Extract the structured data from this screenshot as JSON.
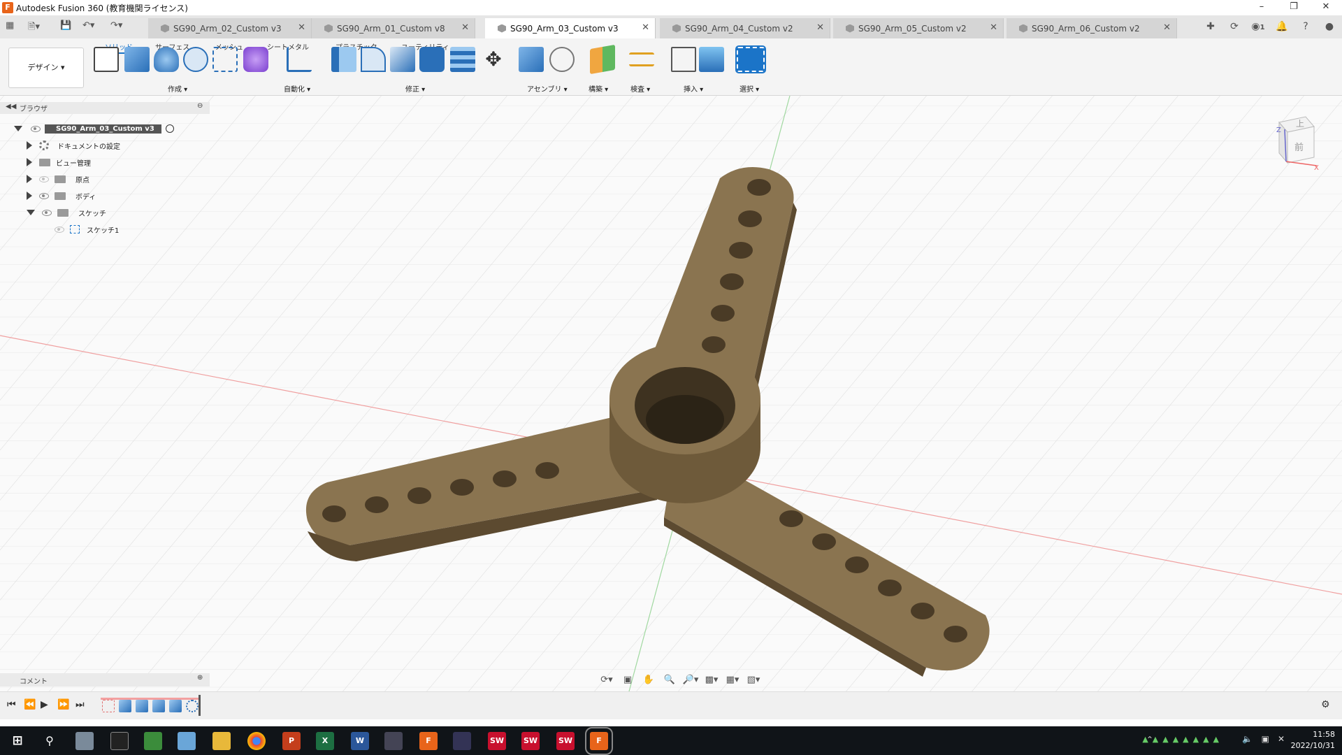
{
  "window": {
    "title": "Autodesk Fusion 360 (教育機関ライセンス)",
    "minimize_icon": "minimize-icon",
    "restore_icon": "restore-icon",
    "close_icon": "close-icon"
  },
  "tabs": [
    {
      "label": "SG90_Arm_02_Custom v3",
      "active": false
    },
    {
      "label": "SG90_Arm_01_Custom v8",
      "active": false
    },
    {
      "label": "SG90_Arm_03_Custom v3",
      "active": true
    },
    {
      "label": "SG90_Arm_04_Custom v2",
      "active": false
    },
    {
      "label": "SG90_Arm_05_Custom v2",
      "active": false
    },
    {
      "label": "SG90_Arm_06_Custom v2",
      "active": false
    }
  ],
  "tab_close_glyph": "✕",
  "header_right": {
    "job_count": "1"
  },
  "toolbar": {
    "workspace": "デザイン",
    "workspace_tabs": [
      "ソリッド",
      "サーフェス",
      "メッシュ",
      "シートメタル",
      "プラスチック",
      "ユーティリティ"
    ],
    "groups": [
      "作成",
      "自動化",
      "修正",
      "アセンブリ",
      "構築",
      "検査",
      "挿入",
      "選択"
    ]
  },
  "browser": {
    "title": "ブラウザ",
    "root": "SG90_Arm_03_Custom v3",
    "items": [
      {
        "label": "ドキュメントの設定",
        "icon": "gear-icon"
      },
      {
        "label": "ビュー管理",
        "icon": "folder-icon"
      },
      {
        "label": "原点",
        "icon": "folder-icon"
      },
      {
        "label": "ボディ",
        "icon": "folder-icon"
      },
      {
        "label": "スケッチ",
        "icon": "folder-icon"
      },
      {
        "label": "スケッチ1",
        "icon": "sketch-icon"
      }
    ]
  },
  "viewcube": {
    "top": "上",
    "front": "前",
    "axis_x": "X",
    "axis_z": "Z"
  },
  "comments": {
    "label": "コメント"
  },
  "clock": {
    "time": "11:58",
    "date": "2022/10/31"
  },
  "colors": {
    "accent": "#1b74c8",
    "model": "#8a7450",
    "model_dark": "#5c4a30",
    "grid": "#d8d8d8",
    "axis_red": "#e88",
    "axis_green": "#8c8",
    "taskbar": "#101418"
  }
}
